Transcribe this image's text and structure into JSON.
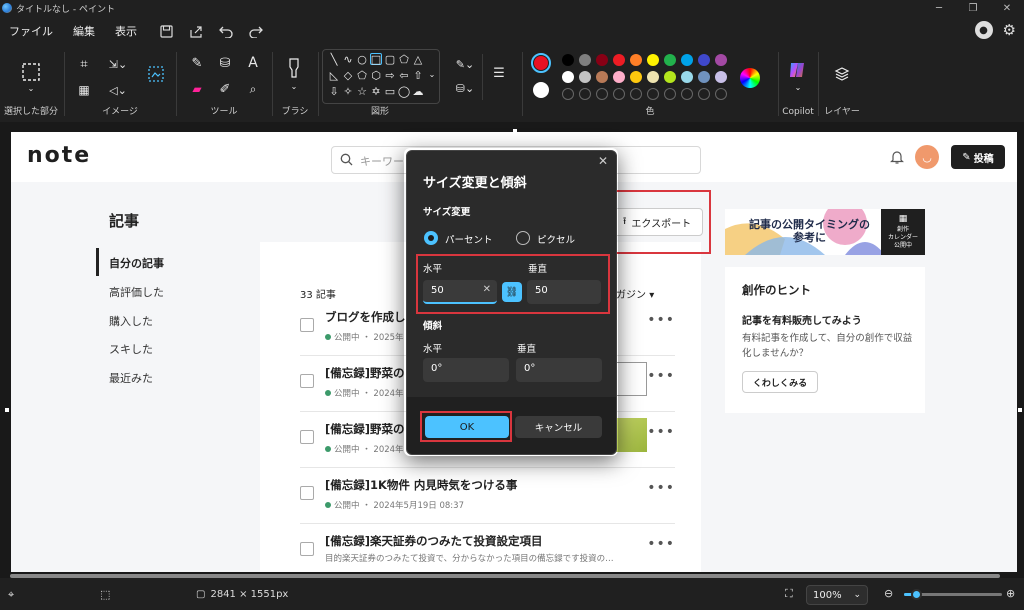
{
  "window": {
    "title": "タイトルなし - ペイント"
  },
  "menu": {
    "file": "ファイル",
    "edit": "編集",
    "view": "表示"
  },
  "ribbon": {
    "groups": {
      "selection": "選択した部分",
      "image": "イメージ",
      "tools": "ツール",
      "brushes": "ブラシ",
      "shapes": "図形",
      "colors": "色",
      "copilot": "Copilot",
      "layers": "レイヤー"
    },
    "primary_color": "#e81123",
    "secondary_color": "#ffffff",
    "palette": [
      "#000000",
      "#7f7f7f",
      "#880015",
      "#ed1c24",
      "#ff7f27",
      "#fff200",
      "#22b14c",
      "#00a2e8",
      "#3f48cc",
      "#a349a4",
      "#ffffff",
      "#c3c3c3",
      "#b97a57",
      "#ffaec9",
      "#ffc90e",
      "#efe4b0",
      "#b5e61d",
      "#99d9ea",
      "#7092be",
      "#c8bfe7"
    ]
  },
  "note_page": {
    "logo": "note",
    "search_placeholder": "キーワー",
    "post_button": "投稿",
    "sidebar_title": "記事",
    "sidebar_items": [
      "自分の記事",
      "高評価した",
      "購入した",
      "スキした",
      "最近みた"
    ],
    "export_button": "エクスポート",
    "article_count": "33 記事",
    "magazine_filter": "ガジン",
    "articles": [
      {
        "title": "ブログを作成し",
        "status": "公開中",
        "date": "2025年"
      },
      {
        "title": "[備忘録]野菜の",
        "status": "公開中",
        "date": "2024年"
      },
      {
        "title": "[備忘録]野菜の",
        "status": "公開中",
        "date": "2024年"
      },
      {
        "title": "[備忘録]1K物件 内見時気をつける事",
        "status": "公開中",
        "date": "2024年5月19日 08:37"
      },
      {
        "title": "[備忘録]楽天証券のつみたて投資設定項目",
        "excerpt": "目的楽天証券のつみたて投資で、分からなかった項目の備忘録です投資の…"
      }
    ],
    "banner": {
      "text": "記事の公開タイミングの参考に",
      "badge_line1": "創作",
      "badge_line2": "カレンダー",
      "badge_line3": "公開中"
    },
    "hint": {
      "title": "創作のヒント",
      "subtitle": "記事を有料販売してみよう",
      "body": "有料記事を作成して、自分の創作で収益化しませんか？",
      "button": "くわしくみる"
    }
  },
  "dialog": {
    "title": "サイズ変更と傾斜",
    "resize_section": "サイズ変更",
    "option_percent": "パーセント",
    "option_pixel": "ピクセル",
    "resize_h_label": "水平",
    "resize_v_label": "垂直",
    "resize_h_value": "50",
    "resize_v_value": "50",
    "skew_section": "傾斜",
    "skew_h_label": "水平",
    "skew_v_label": "垂直",
    "skew_h_value": "0°",
    "skew_v_value": "0°",
    "ok": "OK",
    "cancel": "キャンセル"
  },
  "status": {
    "dimensions": "2841 × 1551px",
    "zoom": "100%",
    "zoom_slider_fraction": 0.12
  }
}
